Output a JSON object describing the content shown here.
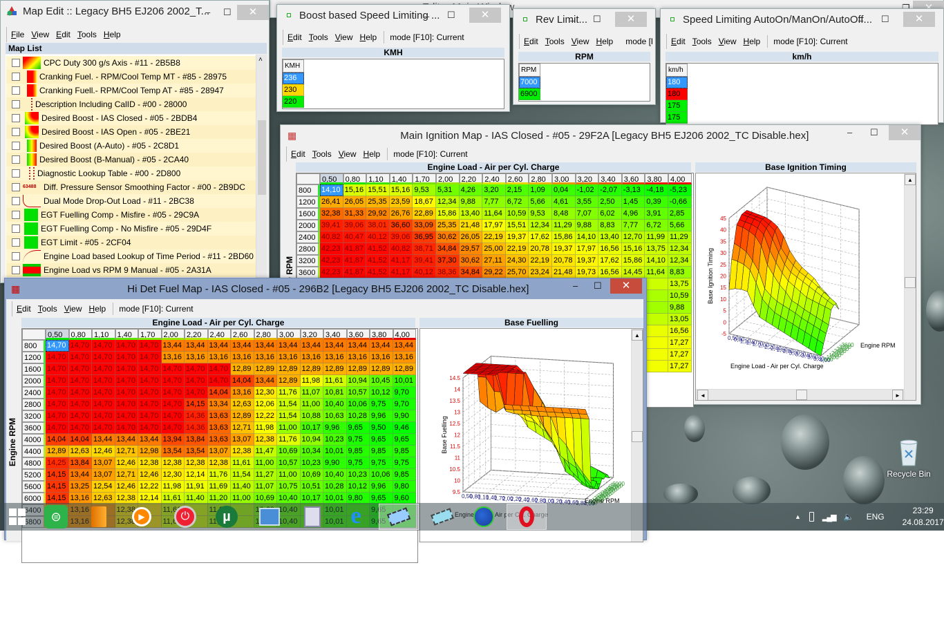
{
  "desktop": {
    "background_window_title": "Editor Main Window",
    "recycle_bin": "Recycle Bin"
  },
  "map_edit": {
    "title": "Map Edit :: Legacy BH5 EJ206 2002_T...",
    "menu": [
      "File",
      "View",
      "Edit",
      "Tools",
      "Help"
    ],
    "list_header": "Map List",
    "items": [
      {
        "label": "CPC Duty 300 g/s Axis - #11 - 2B5B8",
        "icon": "heatmap-red-yellow"
      },
      {
        "label": "Cranking Fuel. - RPM/Cool Temp MT - #85 - 28975",
        "icon": "heatmap-red"
      },
      {
        "label": "Cranking Fuell.- RPM/Cool Temp AT - #85 - 28947",
        "icon": "heatmap-red"
      },
      {
        "label": "Description Including CalID - #00 - 28000",
        "icon": "dotted-column"
      },
      {
        "label": "Desired Boost - IAS Closed - #05 - 2BDB4",
        "icon": "heatmap-green-red"
      },
      {
        "label": "Desired Boost - IAS Open - #05 - 2BE21",
        "icon": "heatmap-green-red"
      },
      {
        "label": "Desired Boost (A-Auto) - #05 - 2C8D1",
        "icon": "heatmap-green-red-narrow"
      },
      {
        "label": "Desired Boost (B-Manual) - #05 - 2CA40",
        "icon": "heatmap-green-red-narrow"
      },
      {
        "label": "Diagnostic Lookup Table - #00 - 2D800",
        "icon": "dotted-grid"
      },
      {
        "label": "Diff. Pressure Sensor Smoothing Factor - #00 - 2B9DC",
        "icon": "value-63488",
        "icon_text": "63488"
      },
      {
        "label": "Dual Mode Drop-Out Load - #11 - 2BC38",
        "icon": "curve-step"
      },
      {
        "label": "EGT Fuelling Comp - Misfire - #05 - 29C9A",
        "icon": "green-block"
      },
      {
        "label": "EGT Fuelling Comp - No Misfire - #05 - 29D4F",
        "icon": "green-block"
      },
      {
        "label": "EGT Limit - #05 - 2CF04",
        "icon": "green-block"
      },
      {
        "label": "Engine Load based Lookup of Time Period - #11 - 2BD60",
        "icon": "curve-decay"
      },
      {
        "label": "Engine Load vs RPM 9 Manual - #05 - 2A31A",
        "icon": "red-green-bar"
      }
    ]
  },
  "boost_window": {
    "title": "Boost based Speed Limiting ...",
    "menu": [
      "Edit",
      "Tools",
      "View",
      "Help"
    ],
    "mode": "mode [F10]: Current",
    "axis": "KMH",
    "col_header": "KMH",
    "values": [
      {
        "v": "236",
        "color": "#3399ff"
      },
      {
        "v": "230",
        "color": "#ffd700"
      },
      {
        "v": "220",
        "color": "#00ee00"
      }
    ]
  },
  "rev_window": {
    "title": "Rev Limit...",
    "menu": [
      "Edit",
      "Tools",
      "View",
      "Help"
    ],
    "mode": "mode [F",
    "axis": "RPM",
    "col_header": "RPM",
    "values": [
      {
        "v": "7000",
        "color": "#3399ff"
      },
      {
        "v": "6900",
        "color": "#00ee00"
      }
    ]
  },
  "speed_window": {
    "title": "Speed Limiting AutoOn/ManOn/AutoOff...",
    "menu": [
      "Edit",
      "Tools",
      "View",
      "Help"
    ],
    "mode": "mode [F10]: Current",
    "axis": "km/h",
    "col_header": "km/h",
    "values": [
      {
        "v": "180",
        "color": "#3399ff"
      },
      {
        "v": "180",
        "color": "#ff0000"
      },
      {
        "v": "175",
        "color": "#00ee00"
      },
      {
        "v": "175",
        "color": "#00ee00"
      }
    ]
  },
  "ignition": {
    "title": "Main Ignition Map - IAS Closed - #05 - 29F2A [Legacy BH5 EJ206 2002_TC Disable.hex]",
    "menu": [
      "Edit",
      "Tools",
      "View",
      "Help"
    ],
    "mode": "mode [F10]: Current",
    "x_axis_title": "Engine Load - Air per Cyl. Charge",
    "y_axis_title": "Engine RPM",
    "cols": [
      "0,50",
      "0,80",
      "1,10",
      "1,40",
      "1,70",
      "2,00",
      "2,20",
      "2,40",
      "2,60",
      "2,80",
      "3,00",
      "3,20",
      "3,40",
      "3,60",
      "3,80",
      "4,00"
    ],
    "rows": [
      {
        "rpm": "800",
        "values": [
          "14,10",
          "15,16",
          "15,51",
          "15,16",
          "9,53",
          "5,31",
          "4,26",
          "3,20",
          "2,15",
          "1,09",
          "0,04",
          "-1,02",
          "-2,07",
          "-3,13",
          "-4,18",
          "-5,23"
        ]
      },
      {
        "rpm": "1200",
        "values": [
          "26,41",
          "26,05",
          "25,35",
          "23,59",
          "18,67",
          "12,34",
          "9,88",
          "7,77",
          "6,72",
          "5,66",
          "4,61",
          "3,55",
          "2,50",
          "1,45",
          "0,39",
          "-0,66"
        ]
      },
      {
        "rpm": "1600",
        "values": [
          "32,38",
          "31,33",
          "29,92",
          "26,76",
          "22,89",
          "15,86",
          "13,40",
          "11,64",
          "10,59",
          "9,53",
          "8,48",
          "7,07",
          "6,02",
          "4,96",
          "3,91",
          "2,85"
        ]
      },
      {
        "rpm": "2000",
        "values": [
          "39,41",
          "39,06",
          "38,01",
          "36,60",
          "33,09",
          "25,35",
          "21,48",
          "17,97",
          "15,51",
          "12,34",
          "11,29",
          "9,88",
          "8,83",
          "7,77",
          "6,72",
          "5,66"
        ]
      },
      {
        "rpm": "2400",
        "values": [
          "40,82",
          "40,47",
          "40,12",
          "39,06",
          "36,95",
          "30,62",
          "26,05",
          "22,19",
          "19,37",
          "17,62",
          "15,86",
          "14,10",
          "13,40",
          "12,70",
          "11,99",
          "11,29"
        ]
      },
      {
        "rpm": "2800",
        "values": [
          "42,23",
          "41,87",
          "41,52",
          "40,82",
          "38,71",
          "34,84",
          "29,57",
          "25,00",
          "22,19",
          "20,78",
          "19,37",
          "17,97",
          "16,56",
          "15,16",
          "13,75",
          "12,34"
        ]
      },
      {
        "rpm": "3200",
        "values": [
          "42,23",
          "41,87",
          "41,52",
          "41,17",
          "39,41",
          "37,30",
          "30,62",
          "27,11",
          "24,30",
          "22,19",
          "20,78",
          "19,37",
          "17,62",
          "15,86",
          "14,10",
          "12,34"
        ]
      },
      {
        "rpm": "3600",
        "values": [
          "42,23",
          "41,87",
          "41,52",
          "41,17",
          "40,12",
          "38,36",
          "34,84",
          "29,22",
          "25,70",
          "23,24",
          "21,48",
          "19,73",
          "16,56",
          "14,45",
          "11,64",
          "8,83"
        ]
      }
    ],
    "more_rows_last_col": [
      "13,75",
      "10,59",
      "9,88",
      "13,05",
      "16,56",
      "17,27",
      "17,27",
      "17,27"
    ],
    "chart": {
      "type": "surface3d",
      "title": "Base Ignition Timing",
      "z_label": "Base Ignition Timing",
      "x_label": "Engine Load - Air per Cyl. Charge",
      "y_label": "Engine RPM",
      "z_ticks": [
        "-5",
        "0",
        "5",
        "10",
        "15",
        "20",
        "25",
        "30",
        "35",
        "40",
        "45"
      ],
      "zlim": [
        -5,
        45
      ]
    }
  },
  "fuel": {
    "title": "Hi Det Fuel Map - IAS Closed - #05 - 296B2 [Legacy BH5 EJ206 2002_TC Disable.hex]",
    "menu": [
      "Edit",
      "Tools",
      "View",
      "Help"
    ],
    "mode": "mode [F10]: Current",
    "x_axis_title": "Engine Load - Air per Cyl. Charge",
    "y_axis_title": "Engine RPM",
    "cols": [
      "0,50",
      "0,80",
      "1,10",
      "1,40",
      "1,70",
      "2,00",
      "2,20",
      "2,40",
      "2,60",
      "2,80",
      "3,00",
      "3,20",
      "3,40",
      "3,60",
      "3,80",
      "4,00"
    ],
    "rows": [
      {
        "rpm": "800",
        "values": [
          "14,70",
          "14,70",
          "14,70",
          "14,70",
          "14,70",
          "13,44",
          "13,44",
          "13,44",
          "13,44",
          "13,44",
          "13,44",
          "13,44",
          "13,44",
          "13,44",
          "13,44",
          "13,44"
        ]
      },
      {
        "rpm": "1200",
        "values": [
          "14,70",
          "14,70",
          "14,70",
          "14,70",
          "14,70",
          "13,16",
          "13,16",
          "13,16",
          "13,16",
          "13,16",
          "13,16",
          "13,16",
          "13,16",
          "13,16",
          "13,16",
          "13,16"
        ]
      },
      {
        "rpm": "1600",
        "values": [
          "14,70",
          "14,70",
          "14,70",
          "14,70",
          "14,70",
          "14,70",
          "14,70",
          "14,70",
          "12,89",
          "12,89",
          "12,89",
          "12,89",
          "12,89",
          "12,89",
          "12,89",
          "12,89"
        ]
      },
      {
        "rpm": "2000",
        "values": [
          "14,70",
          "14,70",
          "14,70",
          "14,70",
          "14,70",
          "14,70",
          "14,70",
          "14,70",
          "14,04",
          "13,44",
          "12,89",
          "11,98",
          "11,61",
          "10,94",
          "10,45",
          "10,01"
        ]
      },
      {
        "rpm": "2400",
        "values": [
          "14,70",
          "14,70",
          "14,70",
          "14,70",
          "14,70",
          "14,70",
          "14,70",
          "14,04",
          "13,16",
          "12,30",
          "11,76",
          "11,07",
          "10,81",
          "10,57",
          "10,12",
          "9,70"
        ]
      },
      {
        "rpm": "2800",
        "values": [
          "14,70",
          "14,70",
          "14,70",
          "14,70",
          "14,70",
          "14,70",
          "14,15",
          "13,34",
          "12,63",
          "12,06",
          "11,54",
          "11,00",
          "10,40",
          "10,06",
          "9,75",
          "9,70"
        ]
      },
      {
        "rpm": "3200",
        "values": [
          "14,70",
          "14,70",
          "14,70",
          "14,70",
          "14,70",
          "14,70",
          "14,36",
          "13,63",
          "12,89",
          "12,22",
          "11,54",
          "10,88",
          "10,63",
          "10,28",
          "9,96",
          "9,90"
        ]
      },
      {
        "rpm": "3600",
        "values": [
          "14,70",
          "14,70",
          "14,70",
          "14,70",
          "14,70",
          "14,70",
          "14,36",
          "13,63",
          "12,71",
          "11,98",
          "11,00",
          "10,17",
          "9,96",
          "9,65",
          "9,50",
          "9,46"
        ]
      },
      {
        "rpm": "4000",
        "values": [
          "14,04",
          "14,04",
          "13,44",
          "13,44",
          "13,44",
          "13,94",
          "13,84",
          "13,63",
          "13,07",
          "12,38",
          "11,76",
          "10,94",
          "10,23",
          "9,75",
          "9,65",
          "9,65"
        ]
      },
      {
        "rpm": "4400",
        "values": [
          "12,89",
          "12,63",
          "12,46",
          "12,71",
          "12,98",
          "13,54",
          "13,54",
          "13,07",
          "12,38",
          "11,47",
          "10,69",
          "10,34",
          "10,01",
          "9,85",
          "9,85",
          "9,85"
        ]
      },
      {
        "rpm": "4800",
        "values": [
          "14,25",
          "13,84",
          "13,07",
          "12,46",
          "12,38",
          "12,38",
          "12,38",
          "12,38",
          "11,61",
          "11,00",
          "10,57",
          "10,23",
          "9,90",
          "9,75",
          "9,75",
          "9,75"
        ]
      },
      {
        "rpm": "5200",
        "values": [
          "14,15",
          "13,44",
          "13,07",
          "12,71",
          "12,46",
          "12,30",
          "12,14",
          "11,76",
          "11,54",
          "11,27",
          "11,00",
          "10,69",
          "10,40",
          "10,23",
          "10,06",
          "9,85"
        ]
      },
      {
        "rpm": "5600",
        "values": [
          "14,15",
          "13,25",
          "12,54",
          "12,46",
          "12,22",
          "11,98",
          "11,91",
          "11,69",
          "11,40",
          "11,07",
          "10,75",
          "10,51",
          "10,28",
          "10,12",
          "9,96",
          "9,80"
        ]
      },
      {
        "rpm": "6000",
        "values": [
          "14,15",
          "13,16",
          "12,63",
          "12,38",
          "12,14",
          "11,61",
          "11,40",
          "11,20",
          "11,00",
          "10,69",
          "10,40",
          "10,17",
          "10,01",
          "9,80",
          "9,65",
          "9,60"
        ]
      },
      {
        "rpm": "6400",
        "values": [
          "",
          "13,16",
          "",
          "12,38",
          "",
          "11,61",
          "",
          "11,20",
          "",
          "10,69",
          "10,40",
          "",
          "10,01",
          "",
          "9,65",
          ""
        ]
      },
      {
        "rpm": "6800",
        "values": [
          "",
          "13,16",
          "",
          "12,38",
          "",
          "11,61",
          "",
          "11,20",
          "",
          "10,69",
          "10,40",
          "",
          "10,01",
          "",
          "9,65",
          ""
        ]
      }
    ],
    "chart": {
      "type": "surface3d",
      "title": "Base Fuelling",
      "z_label": "Base Fuelling",
      "x_label": "Engine Load - Air per Cyl. Charge",
      "y_label": "Engine RPM",
      "z_ticks": [
        "9.5",
        "10",
        "10.5",
        "11",
        "11.5",
        "12",
        "12.5",
        "13",
        "13.5",
        "14",
        "14.5"
      ],
      "zlim": [
        9.5,
        14.5
      ]
    }
  },
  "taskbar": {
    "icons": [
      "windows-start",
      "green-app",
      "archive-book",
      "media-player",
      "power-button",
      "utorrent",
      "control-panel",
      "calculator",
      "internet-explorer",
      "ecuedit-chip",
      "ecu-chip",
      "globe",
      "opera"
    ],
    "tray": {
      "lang": "ENG",
      "time": "23:29",
      "date": "24.08.2017"
    }
  }
}
